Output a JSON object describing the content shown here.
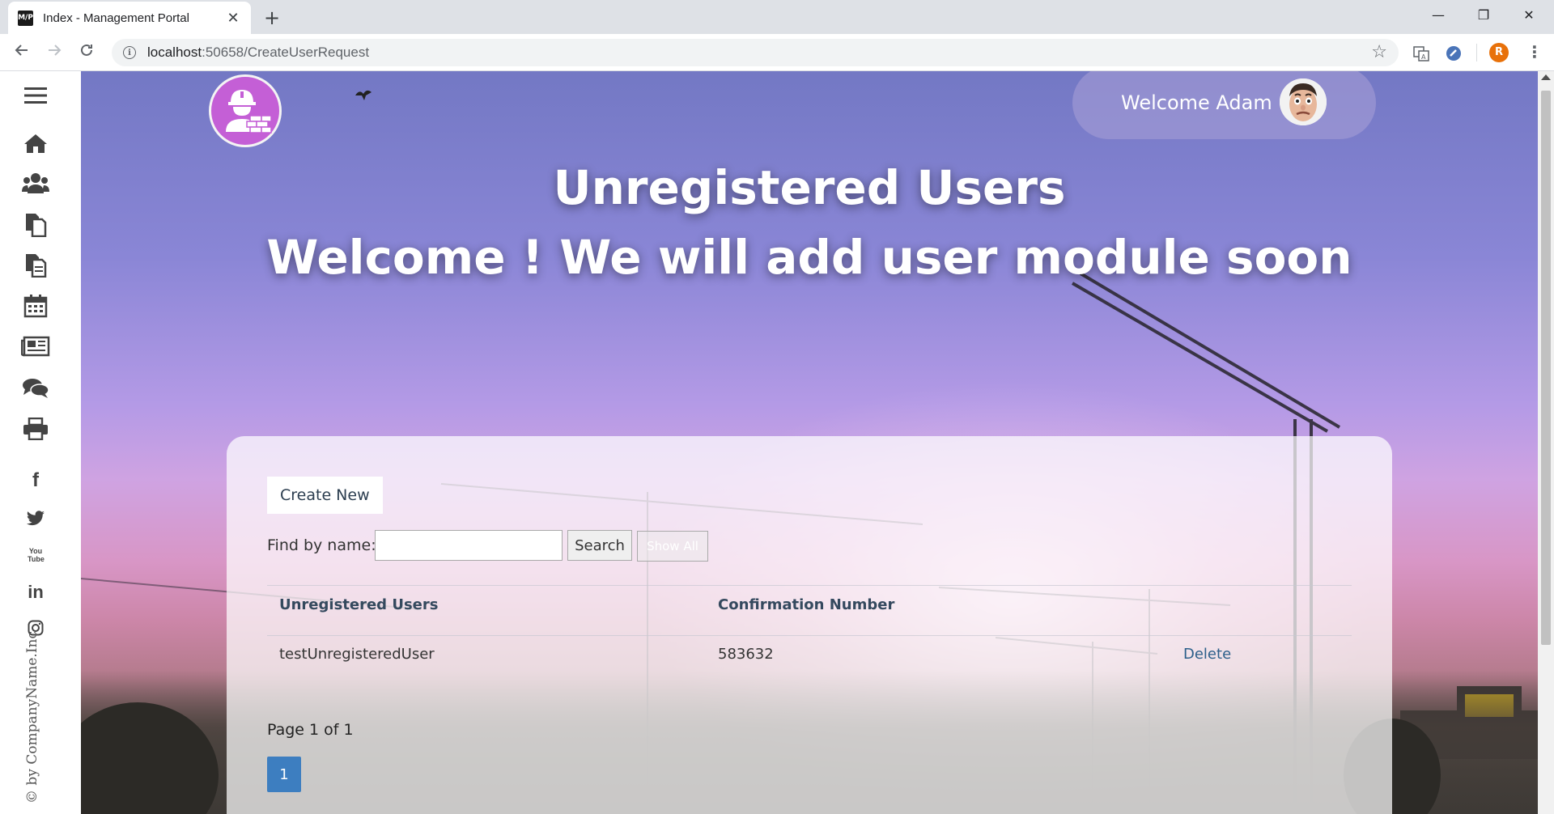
{
  "browser": {
    "tab_title": "Index - Management Portal",
    "favicon_text": "M/P",
    "url_host": "localhost",
    "url_path": ":50658/CreateUserRequest",
    "profile_initial": "R",
    "tab_close_glyph": "✕",
    "new_tab_glyph": "+",
    "window_controls": {
      "minimize": "—",
      "restore": "❐",
      "close": "✕"
    }
  },
  "sidebar": {
    "icons": [
      "menu-icon",
      "home-icon",
      "users-icon",
      "documents-icon",
      "documents-alt-icon",
      "calendar-icon",
      "newspaper-icon",
      "chat-icon",
      "print-icon",
      "facebook-icon",
      "twitter-icon",
      "youtube-icon",
      "linkedin-icon",
      "instagram-icon"
    ],
    "social": {
      "facebook": "f",
      "youtube": "You Tube",
      "linkedin": "in"
    },
    "copyright": "© by CompanyName.Inc"
  },
  "header": {
    "welcome": "Welcome Adam !"
  },
  "hero": {
    "title": "Unregistered Users",
    "subtitle": "Welcome ! We will add user module soon"
  },
  "panel": {
    "create_label": "Create New",
    "find_label": "Find by name:",
    "find_value": "",
    "search_label": "Search",
    "showall_label": "Show All",
    "columns": [
      "Unregistered Users",
      "Confirmation Number"
    ],
    "rows": [
      {
        "user": "testUnregisteredUser",
        "confirmation": "583632",
        "action": "Delete"
      }
    ],
    "page_info": "Page 1 of 1",
    "current_page": "1"
  },
  "colors": {
    "logo_bg": "#c45fd6",
    "page_button": "#3d7ec0",
    "link": "#2c5f8a",
    "profile": "#e8710a"
  }
}
